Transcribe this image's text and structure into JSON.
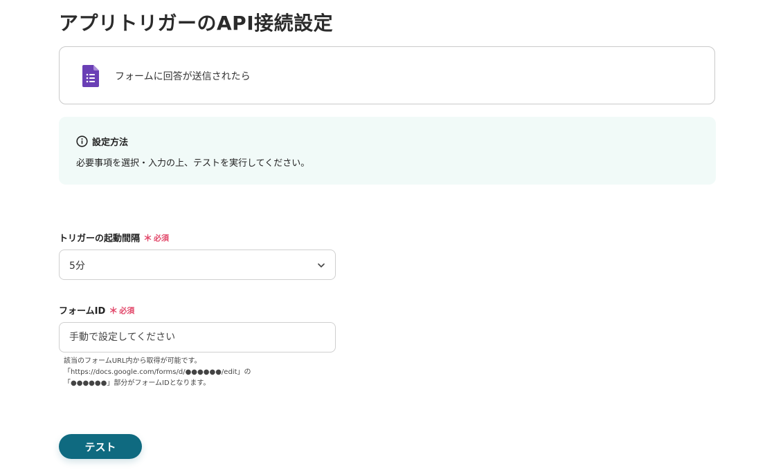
{
  "page": {
    "title": "アプリトリガーのAPI接続設定"
  },
  "trigger": {
    "icon": "google-forms-icon",
    "label": "フォームに回答が送信されたら"
  },
  "info": {
    "icon": "info-icon",
    "title": "設定方法",
    "text": "必要事項を選択・入力の上、テストを実行してください。"
  },
  "fields": {
    "interval": {
      "label": "トリガーの起動間隔",
      "required_mark": "＊",
      "required_text": "必須",
      "value": "5分"
    },
    "form_id": {
      "label": "フォームID",
      "required_mark": "＊",
      "required_text": "必須",
      "placeholder": "手動で設定してください",
      "value": "",
      "help": [
        "該当のフォームURL内から取得が可能です。",
        "「https://docs.google.com/forms/d/●●●●●●/edit」の",
        "「●●●●●●」部分がフォームIDとなります。"
      ]
    }
  },
  "actions": {
    "test_label": "テスト"
  },
  "colors": {
    "accent": "#0f6a80",
    "required": "#e2486a",
    "info_bg": "#f1faf8",
    "forms_purple": "#6a3fb5"
  }
}
